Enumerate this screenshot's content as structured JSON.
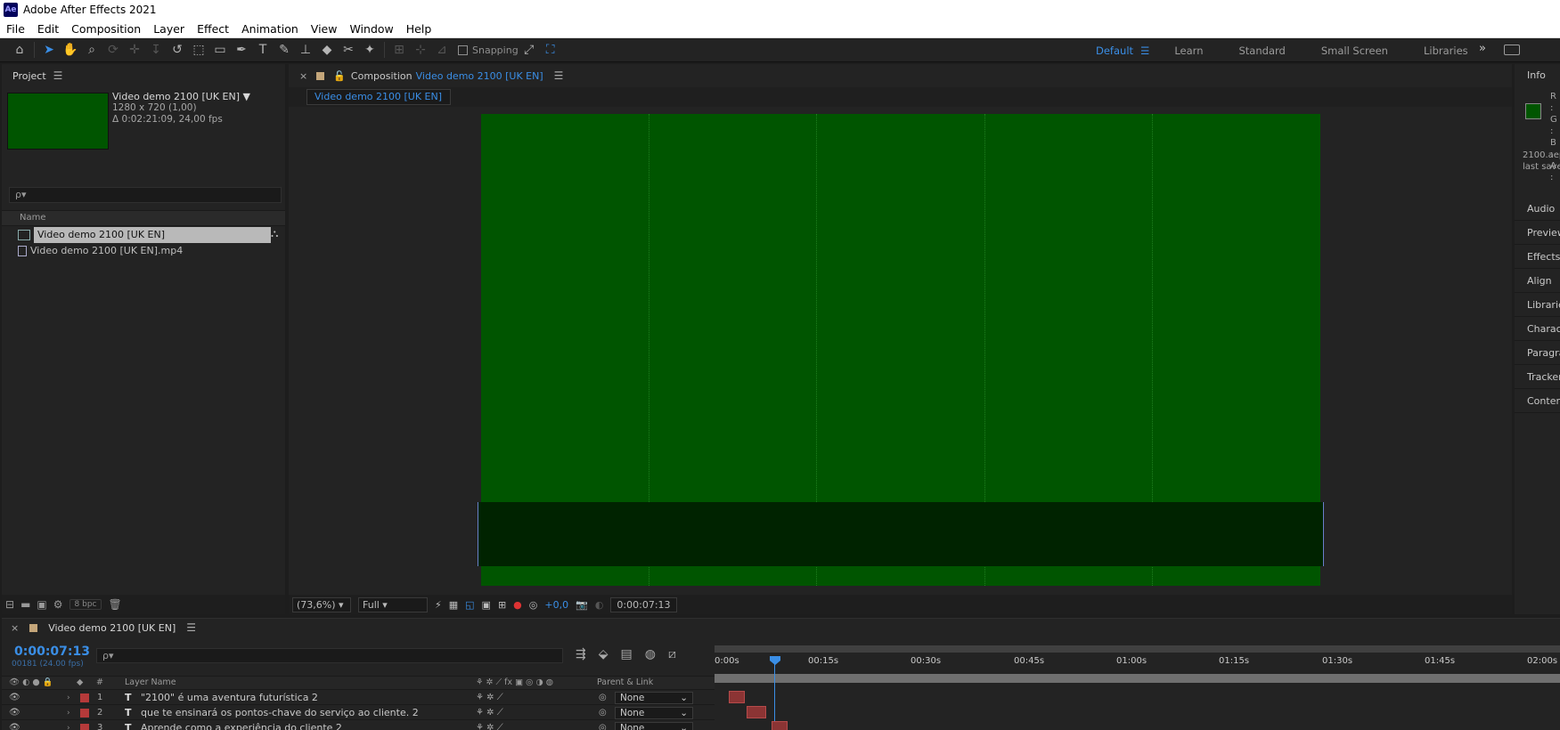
{
  "titlebar": {
    "app_icon": "Ae",
    "title": "Adobe After Effects 2021"
  },
  "menu": [
    "File",
    "Edit",
    "Composition",
    "Layer",
    "Effect",
    "Animation",
    "View",
    "Window",
    "Help"
  ],
  "toolbar": {
    "snapping_label": "Snapping",
    "workspaces": [
      "Default",
      "Learn",
      "Standard",
      "Small Screen",
      "Libraries"
    ],
    "more": "»"
  },
  "project": {
    "title": "Project",
    "item_name": "Video demo 2100 [UK EN]",
    "item_dims": "1280 x 720 (1,00)",
    "item_duration": "Δ 0:02:21:09, 24,00 fps",
    "search_placeholder": "ρ▾",
    "column_name": "Name",
    "items": [
      {
        "name": "Video demo 2100 [UK EN]",
        "type": "composition",
        "selected": true
      },
      {
        "name": "Video demo 2100 [UK EN].mp4",
        "type": "footage",
        "selected": false
      }
    ],
    "bpc": "8 bpc"
  },
  "composition": {
    "close": "×",
    "label": "Composition",
    "name": "Video demo 2100 [UK EN]",
    "tab": "Video demo 2100 [UK EN]",
    "zoom": "(73,6%)",
    "resolution": "Full",
    "exposure": "+0,0",
    "time": "0:00:07:13",
    "canvas_color": "#005500"
  },
  "info": {
    "title": "Info",
    "rgba": [
      "R :",
      "G :",
      "B :",
      "A :"
    ],
    "file": "2100.aep",
    "saved": "last save",
    "panels": [
      "Audio",
      "Preview",
      "Effects &",
      "Align",
      "Libraries",
      "Character",
      "Paragraph",
      "Tracker",
      "Content"
    ]
  },
  "timeline": {
    "close": "×",
    "comp_name": "Video demo 2100 [UK EN]",
    "time": "0:00:07:13",
    "frames": "00181 (24.00 fps)",
    "search_placeholder": "ρ▾",
    "col_hash": "#",
    "col_layer": "Layer Name",
    "col_parent": "Parent & Link",
    "ticks": [
      "0:00s",
      "00:15s",
      "00:30s",
      "00:45s",
      "01:00s",
      "01:15s",
      "01:30s",
      "01:45s",
      "02:00s"
    ],
    "layers": [
      {
        "num": "1",
        "type": "T",
        "name": "\"2100\" é uma aventura futurística 2",
        "parent": "None"
      },
      {
        "num": "2",
        "type": "T",
        "name": "que te ensinará os pontos-chave do serviço ao cliente. 2",
        "parent": "None"
      },
      {
        "num": "3",
        "type": "T",
        "name": "Aprende como a experiência do cliente 2",
        "parent": "None"
      }
    ]
  }
}
